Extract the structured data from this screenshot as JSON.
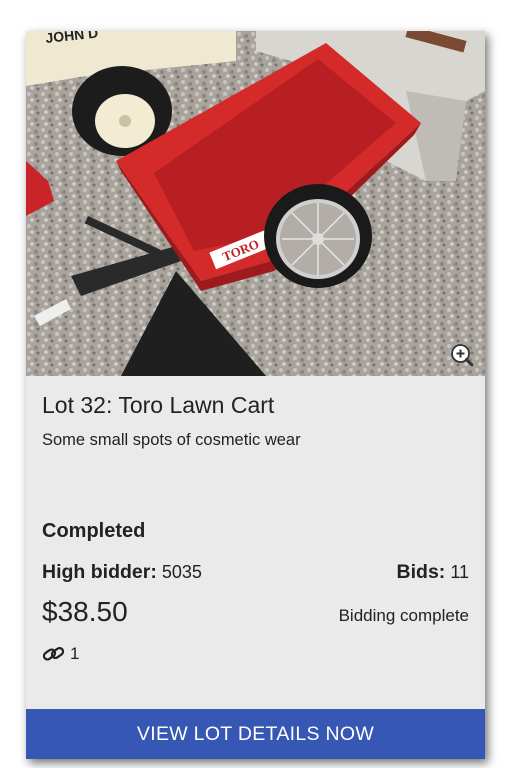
{
  "lot": {
    "number_label": "Lot 32:",
    "name": "Toro Lawn Cart",
    "description": "Some small spots of cosmetic wear",
    "status": "Completed",
    "high_bidder_label": "High bidder:",
    "high_bidder_value": "5035",
    "bids_label": "Bids:",
    "bids_value": "11",
    "price": "$38.50",
    "bidding_status": "Bidding complete",
    "link_count": "1",
    "image_text": {
      "tractor_text": "JOHN D",
      "cart_brand": "TORO"
    }
  },
  "cta": {
    "label": "VIEW LOT DETAILS NOW"
  },
  "icons": {
    "zoom": "zoom-in-icon",
    "link": "link-icon"
  },
  "colors": {
    "card_bg": "#eaeaea",
    "cta_bg": "#3657b4",
    "cart_red": "#d42a2a"
  }
}
